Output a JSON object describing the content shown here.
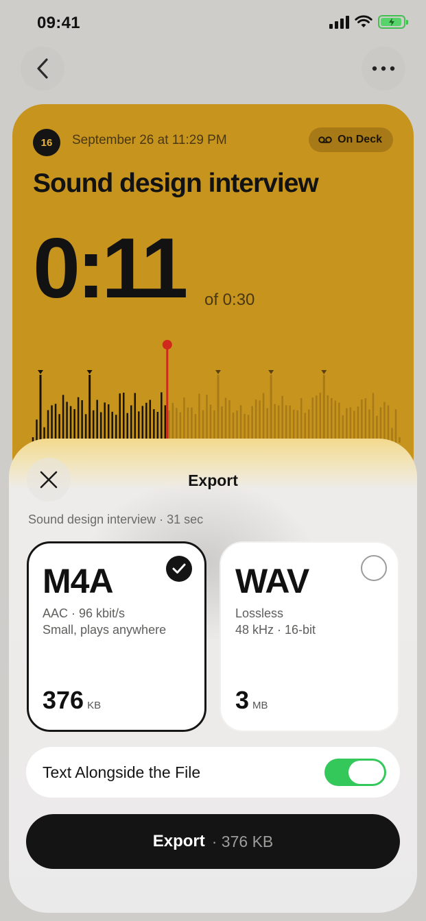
{
  "status_bar": {
    "time": "09:41"
  },
  "memo": {
    "day_number": "16",
    "date": "September 26 at 11:29 PM",
    "badge": "On Deck",
    "title": "Sound design interview",
    "elapsed": "0:11",
    "duration": "of 0:30",
    "playhead_fraction": 0.37,
    "accent_color": "#c7941e"
  },
  "sheet": {
    "title": "Export",
    "subtitle": "Sound design interview · 31 sec",
    "formats": [
      {
        "name": "M4A",
        "line1": "AAC · 96 kbit/s",
        "line2": "Small, plays anywhere",
        "size": "376",
        "unit": "KB",
        "selected": true
      },
      {
        "name": "WAV",
        "line1": "Lossless",
        "line2": "48 kHz · 16-bit",
        "size": "3",
        "unit": "MB",
        "selected": false
      }
    ],
    "toggle": {
      "label": "Text Alongside the File",
      "on": true,
      "color": "#34c759"
    },
    "export_button": {
      "label": "Export",
      "meta": "· 376 KB"
    }
  },
  "icons": {
    "back": "chevron-left-icon",
    "more": "ellipsis-icon",
    "close": "close-icon",
    "check": "checkmark-icon",
    "voicemail": "voicemail-icon"
  }
}
